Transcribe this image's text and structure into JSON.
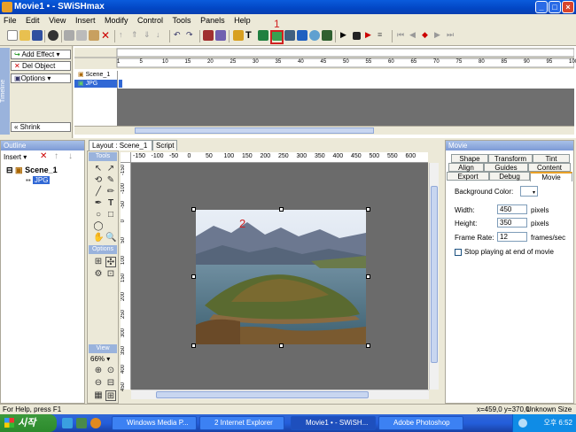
{
  "window": {
    "title": "Movie1 • - SWiSHmax"
  },
  "menu": [
    "File",
    "Edit",
    "View",
    "Insert",
    "Modify",
    "Control",
    "Tools",
    "Panels",
    "Help"
  ],
  "annotations": {
    "label1": "1",
    "label2": "2"
  },
  "timeline": {
    "buttons": {
      "add_effect": "Add Effect",
      "del_object": "Del Object",
      "options": "Options",
      "shrink": "Shrink"
    },
    "side_label": "Timeline",
    "ruler_ticks": [
      "1",
      "5",
      "10",
      "15",
      "20",
      "25",
      "30",
      "35",
      "40",
      "45",
      "50",
      "55",
      "60",
      "65",
      "70",
      "75",
      "80",
      "85",
      "90",
      "95",
      "100"
    ],
    "rows": [
      "Scene_1",
      "JPG"
    ]
  },
  "outline": {
    "header": "Outline",
    "insert_label": "Insert",
    "tree": [
      "Scene_1",
      "JPG"
    ]
  },
  "layout": {
    "tabs": [
      "Layout : Scene_1",
      "Script"
    ],
    "tools_header": "Tools",
    "options_header": "Options",
    "view_header": "View",
    "zoom": "66%",
    "ruler_h": [
      "-150",
      "-100",
      "-50",
      "0",
      "50",
      "100",
      "150",
      "200",
      "250",
      "300",
      "350",
      "400",
      "450",
      "500",
      "550",
      "600"
    ],
    "ruler_v": [
      "-150",
      "-100",
      "-50",
      "0",
      "50",
      "100",
      "150",
      "200",
      "250",
      "300",
      "350",
      "400",
      "450"
    ]
  },
  "movie": {
    "header": "Movie",
    "tabs_row1": [
      "Shape",
      "Transform",
      "Tint"
    ],
    "tabs_row2": [
      "Align",
      "Guides",
      "Content"
    ],
    "tabs_row3": [
      "Export",
      "Debug",
      "Movie"
    ],
    "bg_label": "Background Color:",
    "width_label": "Width:",
    "width_value": "450",
    "width_unit": "pixels",
    "height_label": "Height:",
    "height_value": "350",
    "height_unit": "pixels",
    "fps_label": "Frame Rate:",
    "fps_value": "12",
    "fps_unit": "frames/sec",
    "stop_label": "Stop playing at end of movie"
  },
  "status": {
    "help": "For Help, press F1",
    "coords": "x=459,0 y=370,0",
    "size": "Unknown Size"
  },
  "taskbar": {
    "start": "시작",
    "tasks": [
      "Windows Media P...",
      "2 Internet Explorer",
      "Movie1 • - SWiSH...",
      "Adobe Photoshop"
    ],
    "clock": "오후 6:52"
  }
}
